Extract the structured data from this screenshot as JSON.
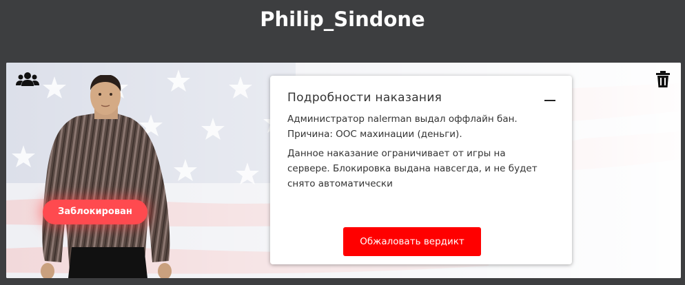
{
  "header": {
    "player_name": "Philip_Sindone"
  },
  "card": {
    "status_badge": "Заблокирован",
    "group_icon": "users-icon",
    "delete_icon": "trash-icon"
  },
  "punishment": {
    "title": "Подробности наказания",
    "collapse_icon": "minus-icon",
    "line1": "Администратор nalerman выдал оффлайн бан.",
    "line2": "Причина: ООС махинации (деньги).",
    "description": "Данное наказание ограничивает от игры на сервере. Блокировка выдана навсегда, и не будет снято автоматически",
    "appeal_button": "Обжаловать вердикт"
  },
  "colors": {
    "header_bg": "#3d3e40",
    "accent_red": "#ff0000",
    "badge_red": "#ff4a4f"
  }
}
